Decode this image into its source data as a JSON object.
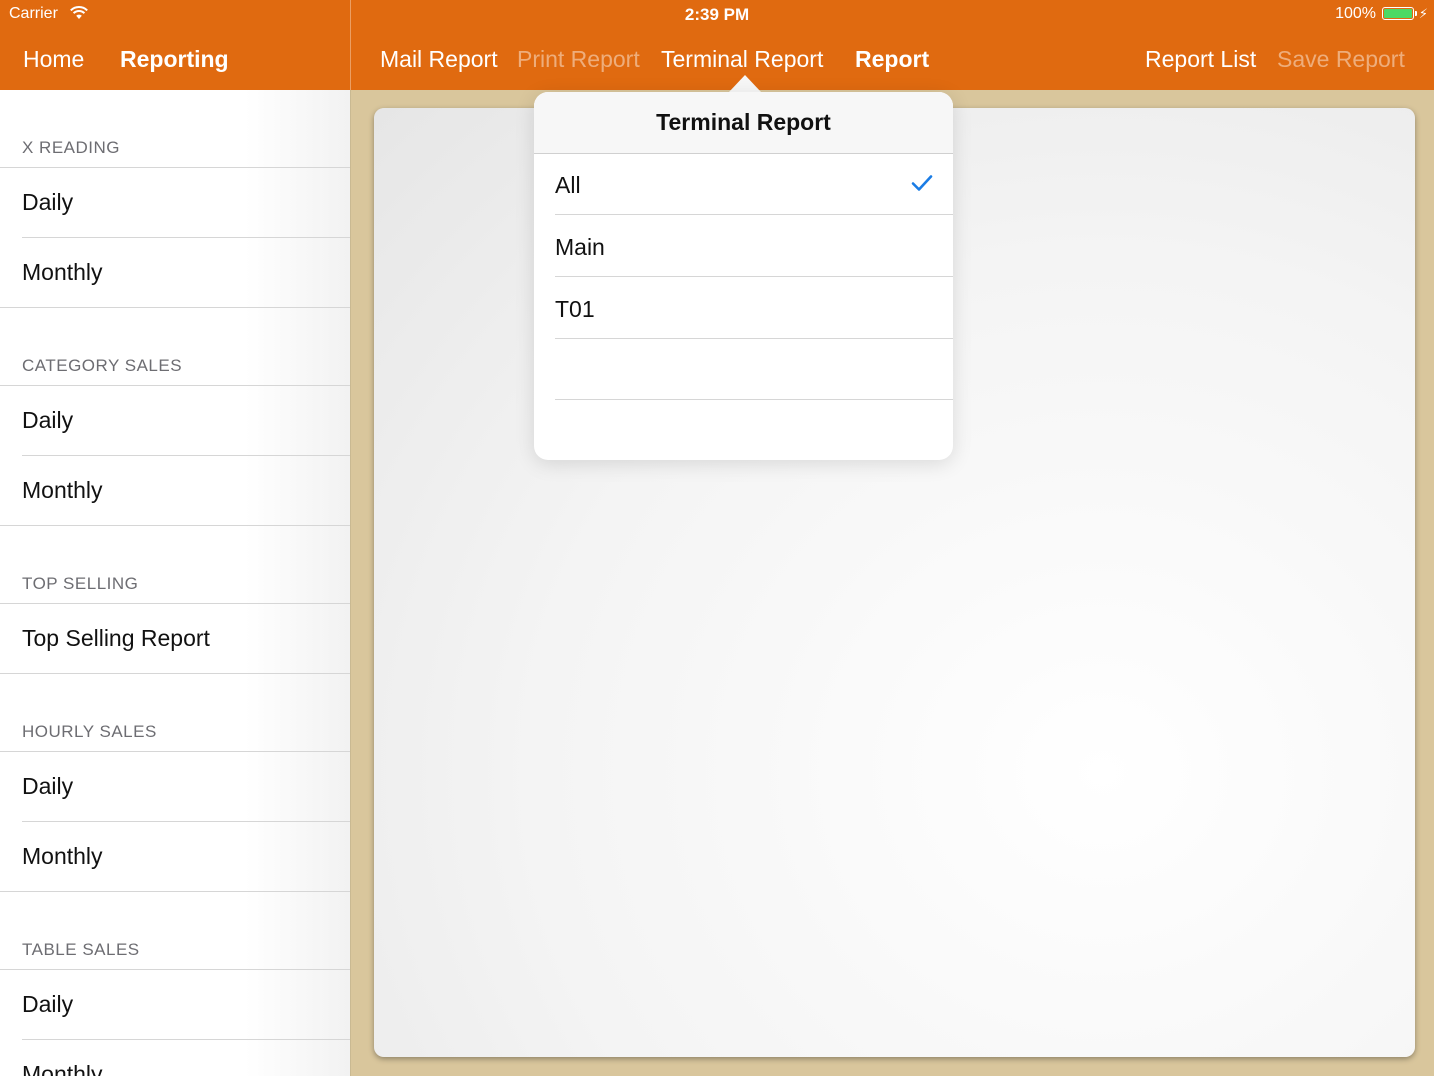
{
  "status": {
    "carrier": "Carrier",
    "time": "2:39 PM",
    "battery": "100%"
  },
  "nav": {
    "home": "Home",
    "reporting": "Reporting",
    "mail_report": "Mail Report",
    "print_report": "Print Report",
    "terminal_report": "Terminal Report",
    "report": "Report",
    "report_list": "Report List",
    "save_report": "Save Report"
  },
  "sidebar": {
    "sections": [
      {
        "header": "X READING",
        "items": [
          "Daily",
          "Monthly"
        ]
      },
      {
        "header": "CATEGORY SALES",
        "items": [
          "Daily",
          "Monthly"
        ]
      },
      {
        "header": "TOP SELLING",
        "items": [
          "Top Selling Report"
        ]
      },
      {
        "header": "HOURLY SALES",
        "items": [
          "Daily",
          "Monthly"
        ]
      },
      {
        "header": "TABLE SALES",
        "items": [
          "Daily",
          "Monthly"
        ]
      }
    ]
  },
  "popover": {
    "title": "Terminal Report",
    "options": [
      "All",
      "Main",
      "T01"
    ],
    "selected": "All"
  },
  "colors": {
    "accent": "#e06a10",
    "check": "#1a7ce5"
  }
}
